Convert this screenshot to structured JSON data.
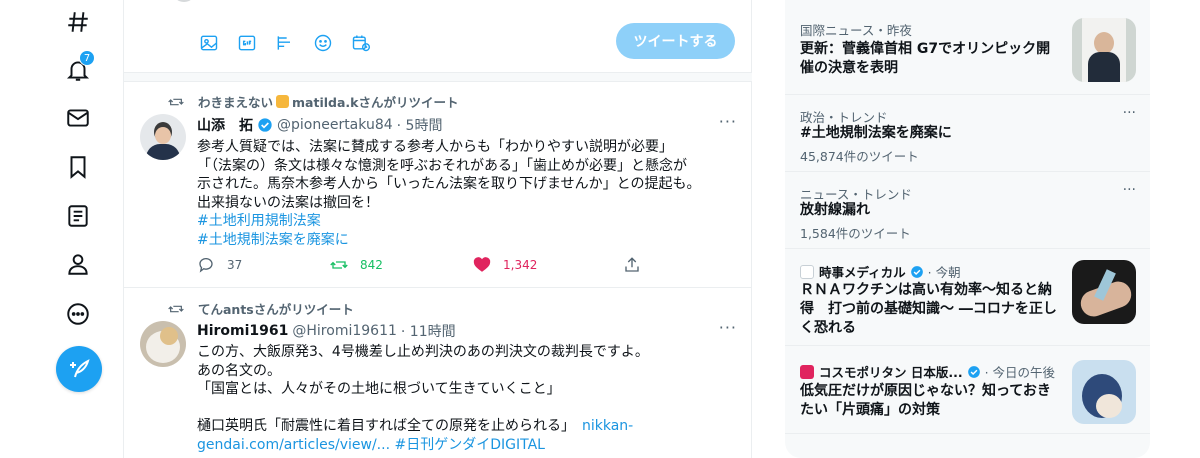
{
  "nav": {
    "notification_count": "7"
  },
  "compose": {
    "tweet_button_label": "ツイートする"
  },
  "tweets": [
    {
      "retweeted_by": "わきまえない",
      "retweeted_by_suffix": "matilda.kさんがリツイート",
      "name": "山添　拓",
      "handle": "@pioneertaku84",
      "time": "· 5時間",
      "text": "参考人質疑では、法案に賛成する参考人からも「わかりやすい説明が必要」\n「（法案の）条文は様々な憶測を呼ぶおそれがある」「歯止めが必要」と懸念が\n示された。馬奈木参考人から「いったん法案を取り下げませんか」との提起も。\n出来損ないの法案は撤回を！",
      "hashtags": [
        "#土地利用規制法案",
        "#土地規制法案を廃案に"
      ],
      "replies": "37",
      "retweets": "842",
      "likes": "1,342"
    },
    {
      "retweeted_by": "てんantsさんがリツイート",
      "name": "Hiromi1961",
      "handle": "@Hiromi19611",
      "time": "· 11時間",
      "text": "この方、大飯原発3、4号機差し止め判決のあの判決文の裁判長ですよ。\nあの名文の。\n「国富とは、人々がその土地に根づいて生きていくこと」\n\n樋口英明氏「耐震性に着目すれば全ての原発を止められる」",
      "link_1": "nikkan-",
      "link_2": "gendai.com/articles/view/...",
      "link_3": "#日刊ゲンダイDIGITAL"
    }
  ],
  "trends": [
    {
      "meta": "国際ニュース・昨夜",
      "title": "更新：菅義偉首相 G7でオリンピック開催の決意を表明"
    },
    {
      "meta": "政治・トレンド",
      "title": "#土地規制法案を廃案に",
      "count": "45,874件のツイート"
    },
    {
      "meta": "ニュース・トレンド",
      "title": "放射線漏れ",
      "count": "1,584件のツイート"
    },
    {
      "source": "時事メディカル",
      "time": "· 今朝",
      "title": "ＲＮＡワクチンは高い有効率～知ると納得　打つ前の基礎知識～ ―コロナを正しく恐れる"
    },
    {
      "source": "コスモポリタン 日本版...",
      "time": "· 今日の午後",
      "title": "低気圧だけが原因じゃない？知っておきたい「片頭痛」の対策"
    }
  ],
  "colors": {
    "accent": "#1da1f2",
    "retweet": "#17bf63",
    "like": "#e0245e"
  }
}
